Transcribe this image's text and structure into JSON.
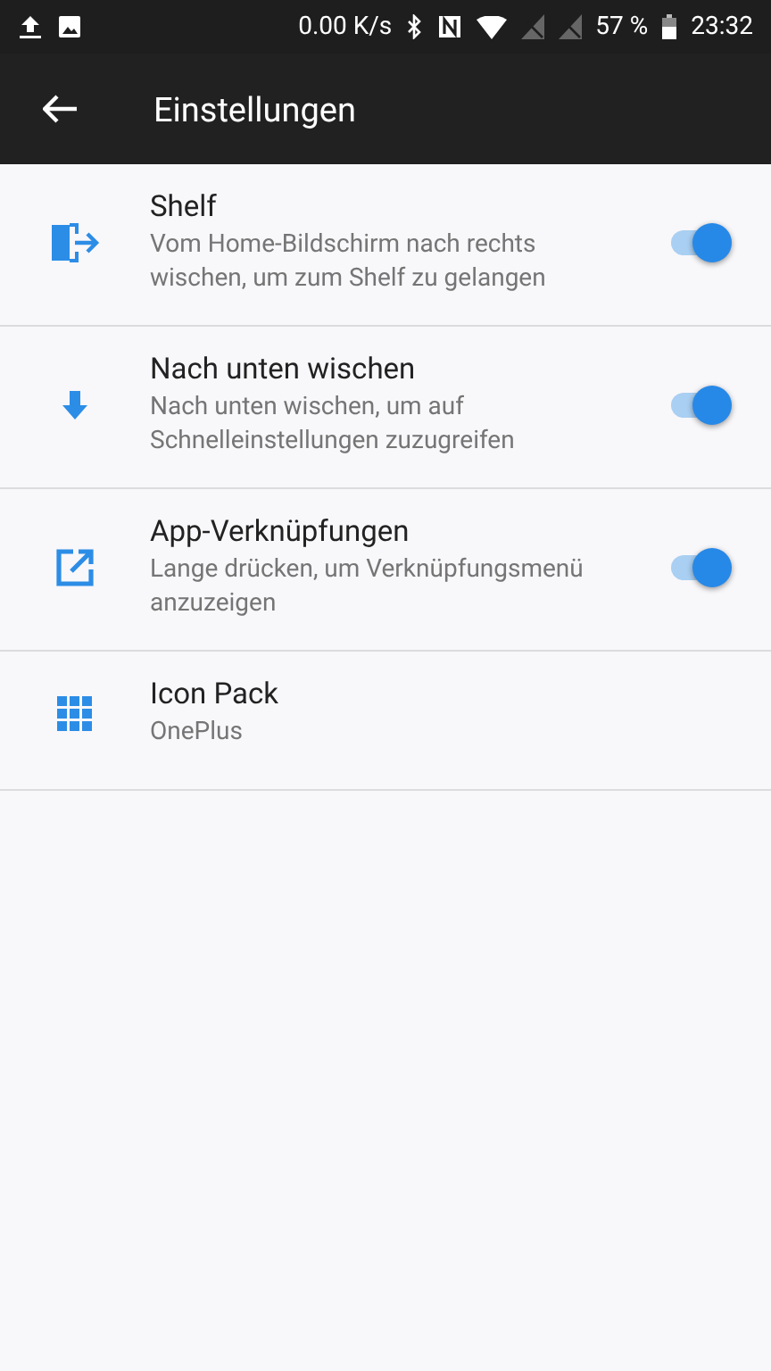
{
  "status_bar": {
    "speed": "0.00 K/s",
    "battery": "57 %",
    "time": "23:32"
  },
  "app_bar": {
    "title": "Einstellungen"
  },
  "settings": [
    {
      "kind": "switch",
      "title": "Shelf",
      "summary": "Vom Home-Bildschirm nach rechts wischen, um zum Shelf zu gelangen",
      "on": true
    },
    {
      "kind": "switch",
      "title": "Nach unten wischen",
      "summary": "Nach unten wischen, um auf Schnelleinstellungen zuzugreifen",
      "on": true
    },
    {
      "kind": "switch",
      "title": "App-Verknüpfungen",
      "summary": "Lange drücken, um Verknüpfungsmenü anzuzeigen",
      "on": true
    },
    {
      "kind": "value",
      "title": "Icon Pack",
      "summary": "OnePlus"
    }
  ]
}
